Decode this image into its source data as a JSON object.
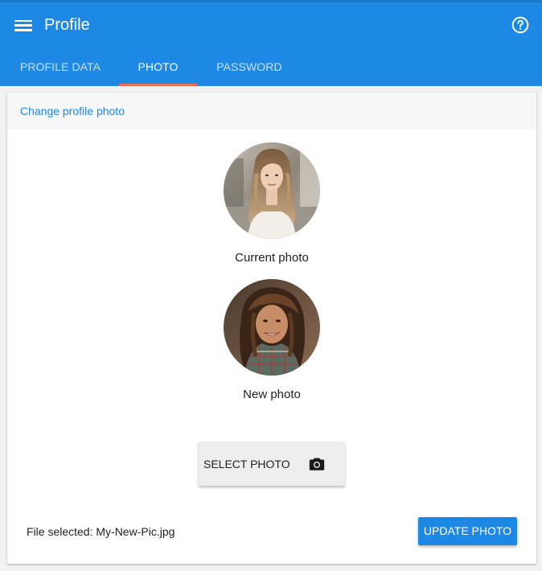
{
  "header": {
    "title": "Profile",
    "menu_icon": "hamburger-menu-icon",
    "help_icon": "help-circle-icon",
    "background": "#1e88e5"
  },
  "tabs": [
    {
      "label": "PROFILE DATA",
      "active": false
    },
    {
      "label": "PHOTO",
      "active": true
    },
    {
      "label": "PASSWORD",
      "active": false
    }
  ],
  "tab_indicator_color": "#ef6c5b",
  "card": {
    "title": "Change profile photo",
    "current_photo_caption": "Current photo",
    "new_photo_caption": "New photo",
    "select_button_label": "SELECT PHOTO",
    "select_button_icon": "camera-icon",
    "file_selected": "File selected: My-New-Pic.jpg",
    "update_button_label": "UPDATE PHOTO"
  }
}
